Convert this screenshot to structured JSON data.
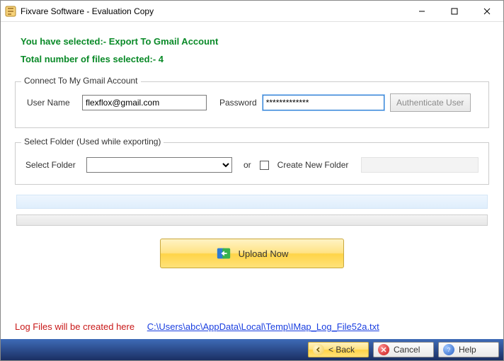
{
  "window": {
    "title": "Fixvare Software - Evaluation Copy"
  },
  "info": {
    "selected_line": "You have selected:- Export To Gmail Account",
    "total_files_line": "Total number of files selected:- 4"
  },
  "connect_group": {
    "legend": "Connect To My Gmail Account",
    "username_label": "User Name",
    "username_value": "flexflox@gmail.com",
    "password_label": "Password",
    "password_value": "*************",
    "auth_button": "Authenticate User"
  },
  "folder_group": {
    "legend": "Select Folder (Used while exporting)",
    "select_label": "Select Folder",
    "or_label": "or",
    "create_label": "Create New Folder"
  },
  "upload_button": "Upload Now",
  "log": {
    "prefix": "Log Files will be created here",
    "path": "C:\\Users\\abc\\AppData\\Local\\Temp\\IMap_Log_File52a.txt"
  },
  "nav": {
    "back": "< Back",
    "cancel": "Cancel",
    "help": "Help"
  }
}
